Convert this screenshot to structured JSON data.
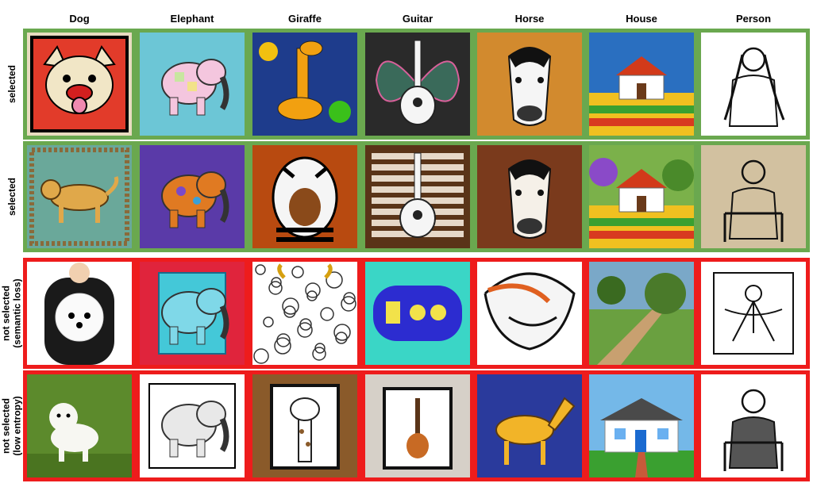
{
  "columns": [
    "Dog",
    "Elephant",
    "Giraffe",
    "Guitar",
    "Horse",
    "House",
    "Person"
  ],
  "rows": [
    {
      "label_lines": [
        "selected"
      ],
      "status": "selected"
    },
    {
      "label_lines": [
        "selected"
      ],
      "status": "selected"
    },
    {
      "label_lines": [
        "not selected",
        "(semantic loss)"
      ],
      "status": "rejected"
    },
    {
      "label_lines": [
        "not selected",
        "(low entropy)"
      ],
      "status": "rejected"
    }
  ],
  "colors": {
    "selected_border": "#6aa84f",
    "rejected_border": "#ee1c1c"
  },
  "tiles": [
    [
      {
        "subject": "dog",
        "desc": "pop-art bulldog face in black frame",
        "bg": "#e8dcc0"
      },
      {
        "subject": "elephant",
        "desc": "patchwork pastel elephant",
        "bg": "#6cc6d6"
      },
      {
        "subject": "giraffe",
        "desc": "swirly painted giraffe",
        "bg": "#1e3c8c"
      },
      {
        "subject": "guitar",
        "desc": "guitar on butterfly pattern",
        "bg": "#2a2a2a"
      },
      {
        "subject": "horse",
        "desc": "horse head on orange wall",
        "bg": "#d28a2e"
      },
      {
        "subject": "house",
        "desc": "farmhouse over striped fields",
        "bg": "#2a6fc0"
      },
      {
        "subject": "person",
        "desc": "line drawing of a woman",
        "bg": "#ffffff"
      }
    ],
    [
      {
        "subject": "dog",
        "desc": "dog on ornate rug",
        "bg": "#6aa89a"
      },
      {
        "subject": "elephant",
        "desc": "spotted orange elephant",
        "bg": "#5a3aa8"
      },
      {
        "subject": "giraffe",
        "desc": "giraffe face close-up",
        "bg": "#b84a10"
      },
      {
        "subject": "guitar",
        "desc": "guitar on wooden planks",
        "bg": "#5a3418"
      },
      {
        "subject": "horse",
        "desc": "white horse in wind",
        "bg": "#7a3a1c"
      },
      {
        "subject": "house",
        "desc": "white house with trees",
        "bg": "#7bb14a"
      },
      {
        "subject": "person",
        "desc": "sketch of man on chair",
        "bg": "#d2c1a0"
      }
    ],
    [
      {
        "subject": "dog",
        "desc": "person holding white dog",
        "bg": "#ffffff"
      },
      {
        "subject": "elephant",
        "desc": "blue elephant print on red",
        "bg": "#e0243c"
      },
      {
        "subject": "giraffe",
        "desc": "doodle circles pattern",
        "bg": "#ffffff"
      },
      {
        "subject": "guitar",
        "desc": "abstract blue guitar",
        "bg": "#3ad6c6"
      },
      {
        "subject": "horse",
        "desc": "abstract swirling horse",
        "bg": "#ffffff"
      },
      {
        "subject": "house",
        "desc": "landscape with road and trees",
        "bg": "#7aa8c8"
      },
      {
        "subject": "person",
        "desc": "ornamental line figure",
        "bg": "#ffffff"
      }
    ],
    [
      {
        "subject": "dog",
        "desc": "white fluffy dog on green",
        "bg": "#5c8a2c"
      },
      {
        "subject": "elephant",
        "desc": "engraved elephant print",
        "bg": "#ffffff"
      },
      {
        "subject": "giraffe",
        "desc": "framed giraffe cartoon",
        "bg": "#8a5a2a"
      },
      {
        "subject": "guitar",
        "desc": "framed guitar on brick wall",
        "bg": "#d6d0c8"
      },
      {
        "subject": "horse",
        "desc": "yellow horse on blue",
        "bg": "#2a3a9c"
      },
      {
        "subject": "house",
        "desc": "white cottage and lawn",
        "bg": "#74b8e8"
      },
      {
        "subject": "person",
        "desc": "man in suit on chair",
        "bg": "#ffffff"
      }
    ]
  ]
}
